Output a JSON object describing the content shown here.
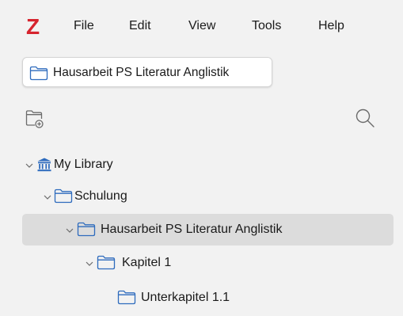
{
  "app": {
    "logo": "Z"
  },
  "menu": [
    "File",
    "Edit",
    "View",
    "Tools",
    "Help"
  ],
  "tab": {
    "label": "Hausarbeit PS Literatur Anglistik"
  },
  "toolbar": {
    "new_collection_icon": "new-collection-icon",
    "search_icon": "search-icon"
  },
  "tree": [
    {
      "label": "My Library",
      "icon": "library-icon",
      "expanded": true
    },
    {
      "label": "Schulung",
      "icon": "folder-icon",
      "expanded": true
    },
    {
      "label": "Hausarbeit PS Literatur Anglistik",
      "icon": "folder-icon",
      "expanded": true,
      "selected": true
    },
    {
      "label": "Kapitel 1",
      "icon": "folder-icon",
      "expanded": true
    },
    {
      "label": "Unterkapitel 1.1",
      "icon": "folder-icon",
      "expanded": false
    }
  ],
  "colors": {
    "logo": "#d6242e",
    "folder": "#2e6bbd",
    "selection": "#dcdcdc",
    "background": "#f2f2f2"
  }
}
